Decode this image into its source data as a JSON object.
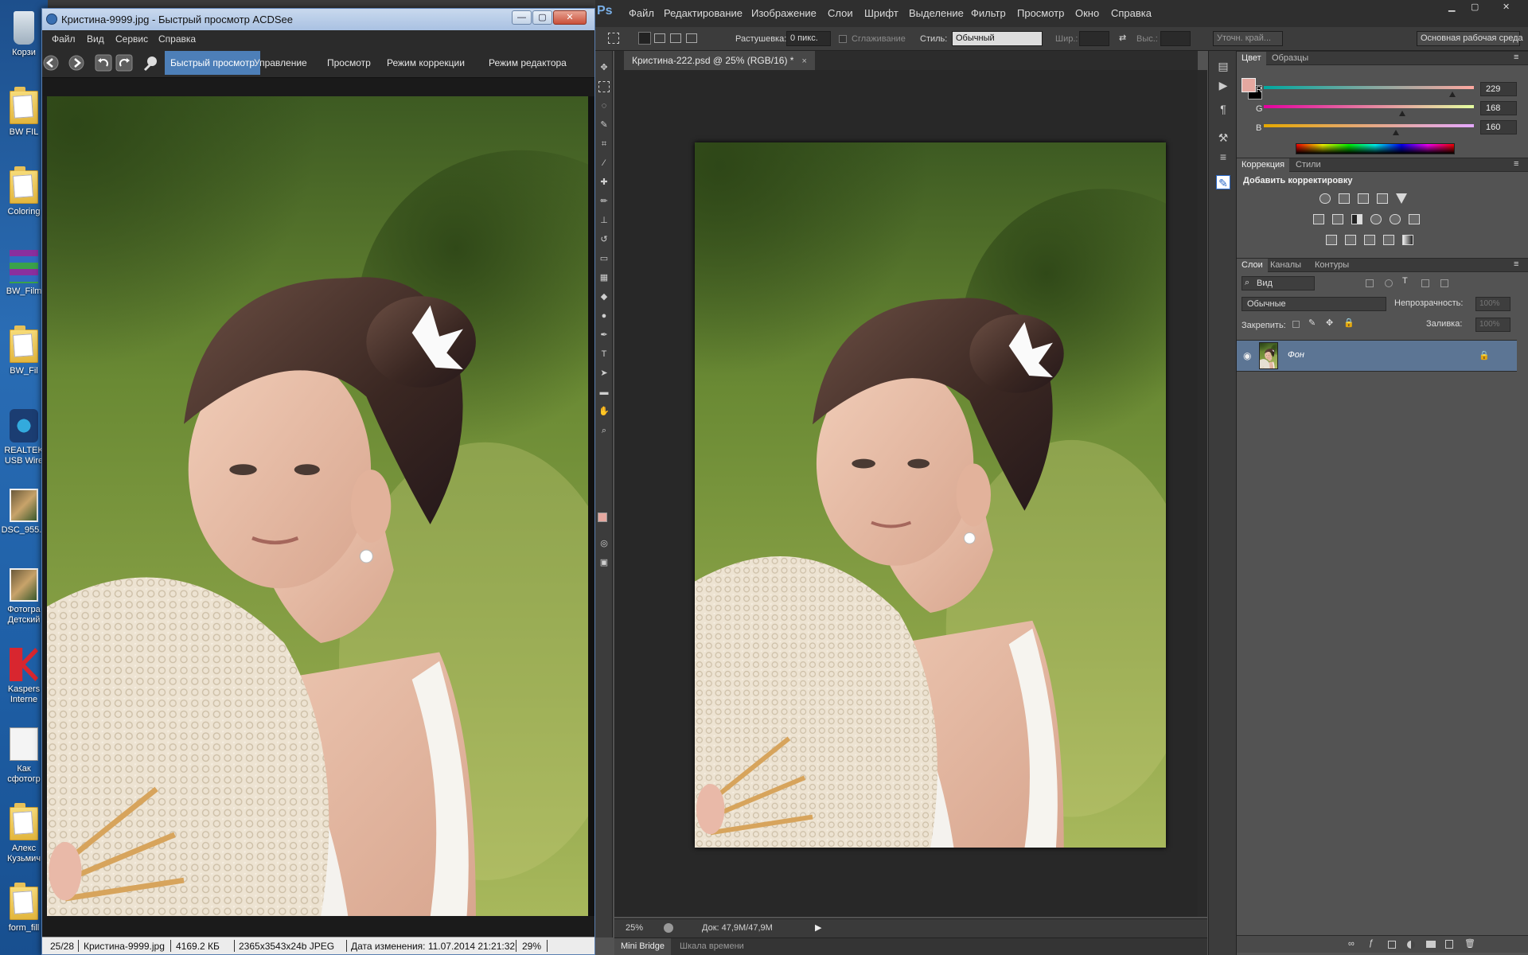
{
  "desktop": {
    "icons": [
      {
        "label": "Корзи",
        "kind": "trash"
      },
      {
        "label": "BW FIL",
        "kind": "folder"
      },
      {
        "label": "Coloring",
        "kind": "folder"
      },
      {
        "label": "BW_Film",
        "kind": "archive"
      },
      {
        "label": "BW_Fil",
        "kind": "folder"
      },
      {
        "label": "REALTEK\nUSB Wire",
        "kind": "network"
      },
      {
        "label": "DSC_955...",
        "kind": "photo"
      },
      {
        "label": "Фотогра\nДетский",
        "kind": "photo"
      },
      {
        "label": "Kaspers\nInterne",
        "kind": "kaspersky"
      },
      {
        "label": "Как\nсфотогр",
        "kind": "doc"
      },
      {
        "label": "Алекс\nКузьмич",
        "kind": "folder"
      },
      {
        "label": "form_fill",
        "kind": "folder"
      }
    ]
  },
  "acdsee": {
    "title": "Кристина-9999.jpg - Быстрый просмотр ACDSee",
    "window_buttons": {
      "minimize": "—",
      "maximize": "▢",
      "close": "✕"
    },
    "menu": [
      "Файл",
      "Вид",
      "Сервис",
      "Справка"
    ],
    "modes": [
      "Быстрый просмотр",
      "Управление",
      "Просмотр",
      "Режим коррекции",
      "Режим редактора"
    ],
    "active_mode": "Быстрый просмотр",
    "status": {
      "position": "25/28",
      "filename": "Кристина-9999.jpg",
      "filesize": "4169.2 КБ",
      "dimensions": "2365x3543x24b JPEG",
      "modified": "Дата изменения: 11.07.2014 21:21:32",
      "zoom": "29%"
    }
  },
  "photoshop": {
    "logo": "Ps",
    "menu": [
      "Файл",
      "Редактирование",
      "Изображение",
      "Слои",
      "Шрифт",
      "Выделение",
      "Фильтр",
      "Просмотр",
      "Окно",
      "Справка"
    ],
    "options": {
      "feather_label": "Растушевка:",
      "feather_value": "0 пикс.",
      "antialias_label": "Сглаживание",
      "style_label": "Стиль:",
      "style_value": "Обычный",
      "width_label": "Шир.:",
      "height_label": "Выс.:",
      "refine_edge": "Уточн. край...",
      "workspace": "Основная рабочая среда"
    },
    "document_tab": "Кристина-222.psd @ 25% (RGB/16) *",
    "document_tab_close": "×",
    "statusbar": {
      "zoom": "25%",
      "doc": "Док: 47,9M/47,9M"
    },
    "bottom_tabs": [
      "Mini Bridge",
      "Шкала времени"
    ],
    "color_panel": {
      "tabs": [
        "Цвет",
        "Образцы"
      ],
      "foreground": "#e5a8a0",
      "channels": [
        {
          "label": "R",
          "value": 229
        },
        {
          "label": "G",
          "value": 168
        },
        {
          "label": "B",
          "value": 160
        }
      ]
    },
    "adjustments_panel": {
      "tabs": [
        "Коррекция",
        "Стили"
      ],
      "heading": "Добавить корректировку"
    },
    "layers_panel": {
      "tabs": [
        "Слои",
        "Каналы",
        "Контуры"
      ],
      "filter_label": "Вид",
      "blend_mode": "Обычные",
      "opacity_label": "Непрозрачность:",
      "opacity_value": "100%",
      "lock_label": "Закрепить:",
      "fill_label": "Заливка:",
      "fill_value": "100%",
      "layers": [
        {
          "name": "Фон",
          "visible": true,
          "locked": true
        }
      ]
    }
  }
}
